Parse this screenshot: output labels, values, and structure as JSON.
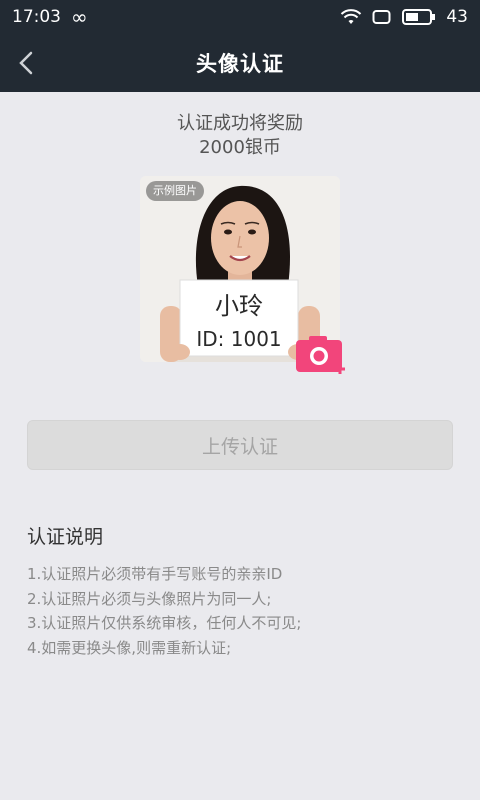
{
  "status_bar": {
    "time": "17:03",
    "loop_symbol": "∞",
    "battery_level": "43",
    "icons": [
      "wifi-icon",
      "notification-icon",
      "battery-icon"
    ]
  },
  "header": {
    "title": "头像认证",
    "back_icon": "chevron-left-icon"
  },
  "reward": {
    "line1": "认证成功将奖励",
    "line2": "2000银币"
  },
  "sample_photo": {
    "tag": "示例图片",
    "sign_line1": "小玲",
    "sign_line2": "ID: 1001"
  },
  "camera_button": {
    "icon": "camera-add-icon",
    "color": "#f2457b"
  },
  "upload_button": {
    "label": "上传认证"
  },
  "instructions": {
    "title": "认证说明",
    "items": [
      "1.认证照片必须带有手写账号的亲亲ID",
      "2.认证照片必须与头像照片为同一人;",
      "3.认证照片仅供系统审核，任何人不可见;",
      "4.如需更换头像,则需重新认证;"
    ]
  },
  "colors": {
    "header_bg": "#222a33",
    "page_bg": "#eaeaee",
    "accent": "#f2457b"
  }
}
